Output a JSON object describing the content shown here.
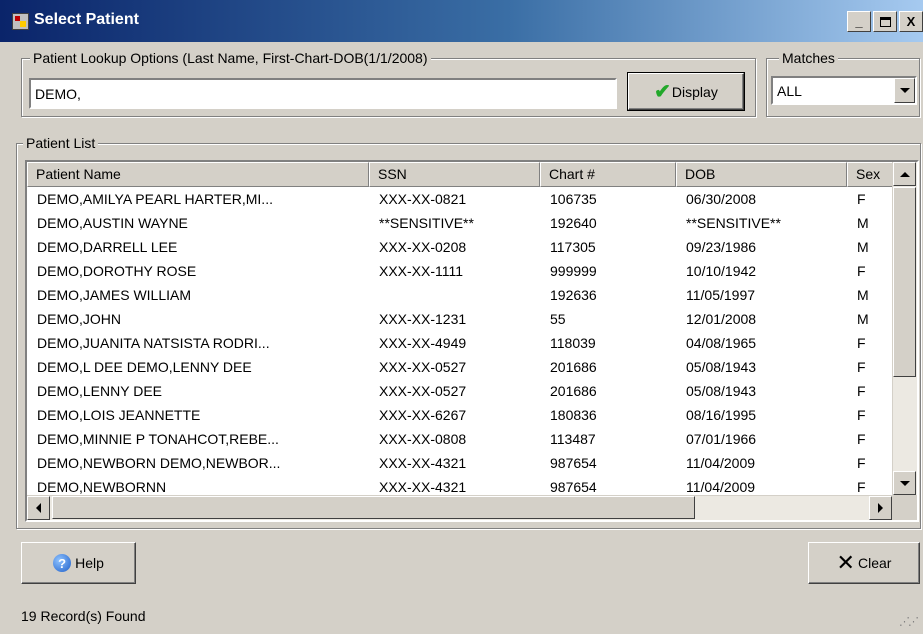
{
  "window": {
    "title": "Select Patient",
    "controls": {
      "minimize": "_",
      "close": "X"
    }
  },
  "lookup": {
    "label": "Patient Lookup Options (Last Name, First-Chart-DOB(1/1/2008)",
    "value": "DEMO,",
    "display_button": "Display"
  },
  "matches": {
    "label": "Matches",
    "selected": "ALL"
  },
  "patient_list": {
    "label": "Patient List",
    "columns": [
      "Patient Name",
      "SSN",
      "Chart #",
      "DOB",
      "Sex"
    ],
    "rows": [
      [
        "DEMO,AMILYA PEARL  HARTER,MI...",
        "XXX-XX-0821",
        "106735",
        "06/30/2008",
        "F"
      ],
      [
        "DEMO,AUSTIN WAYNE",
        "**SENSITIVE**",
        "192640",
        "**SENSITIVE**",
        "M"
      ],
      [
        "DEMO,DARRELL LEE",
        "XXX-XX-0208",
        "117305",
        "09/23/1986",
        "M"
      ],
      [
        "DEMO,DOROTHY ROSE",
        "XXX-XX-1111",
        "999999",
        "10/10/1942",
        "F"
      ],
      [
        "DEMO,JAMES WILLIAM",
        "",
        "192636",
        "11/05/1997",
        "M"
      ],
      [
        "DEMO,JOHN",
        "XXX-XX-1231",
        "55",
        "12/01/2008",
        "M"
      ],
      [
        "DEMO,JUANITA NATSISTA  RODRI...",
        "XXX-XX-4949",
        "118039",
        "04/08/1965",
        "F"
      ],
      [
        "DEMO,L DEE  DEMO,LENNY DEE",
        "XXX-XX-0527",
        "201686",
        "05/08/1943",
        "F"
      ],
      [
        "DEMO,LENNY DEE",
        "XXX-XX-0527",
        "201686",
        "05/08/1943",
        "F"
      ],
      [
        "DEMO,LOIS JEANNETTE",
        "XXX-XX-6267",
        "180836",
        "08/16/1995",
        "F"
      ],
      [
        "DEMO,MINNIE P  TONAHCOT,REBE...",
        "XXX-XX-0808",
        "113487",
        "07/01/1966",
        "F"
      ],
      [
        "DEMO,NEWBORN  DEMO,NEWBOR...",
        "XXX-XX-4321",
        "987654",
        "11/04/2009",
        "F"
      ],
      [
        "DEMO,NEWBORNN",
        "XXX-XX-4321",
        "987654",
        "11/04/2009",
        "F"
      ]
    ]
  },
  "buttons": {
    "help": "Help",
    "clear": "Clear"
  },
  "status": {
    "text": "19 Record(s) Found"
  }
}
